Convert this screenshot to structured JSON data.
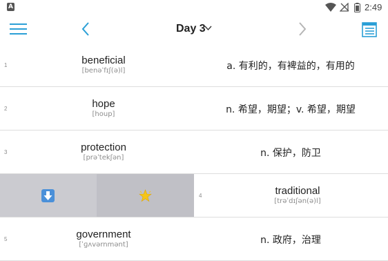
{
  "statusbar": {
    "app_icon_letter": "A",
    "icons": [
      "wifi-icon",
      "no-signal-icon",
      "battery-icon"
    ],
    "time": "2:49"
  },
  "toolbar": {
    "title": "Day 3",
    "icons": [
      "menu-icon",
      "chevron-left-icon",
      "chevron-down-icon",
      "chevron-right-icon",
      "list-view-icon"
    ],
    "accent_color": "#2a9fd6"
  },
  "rows": [
    {
      "index": "1",
      "word": "beneficial",
      "phonetic": "[benəˈfɪʃ(ə)l]",
      "meaning": "a. 有利的，有裨益的，有用的"
    },
    {
      "index": "2",
      "word": "hope",
      "phonetic": "[houp]",
      "meaning": "n. 希望，期望；v. 希望，期望"
    },
    {
      "index": "3",
      "word": "protection",
      "phonetic": "[prəˈtekʃən]",
      "meaning": "n. 保护，防卫"
    },
    {
      "index": "4",
      "word": "traditional",
      "phonetic": "[trəˈdɪʃən(ə)l]",
      "meaning": "",
      "swiped": true,
      "actions": [
        "download-icon",
        "star-icon"
      ]
    },
    {
      "index": "5",
      "word": "government",
      "phonetic": "[ˈɡʌvərnmənt]",
      "meaning": "n. 政府，治理"
    }
  ]
}
